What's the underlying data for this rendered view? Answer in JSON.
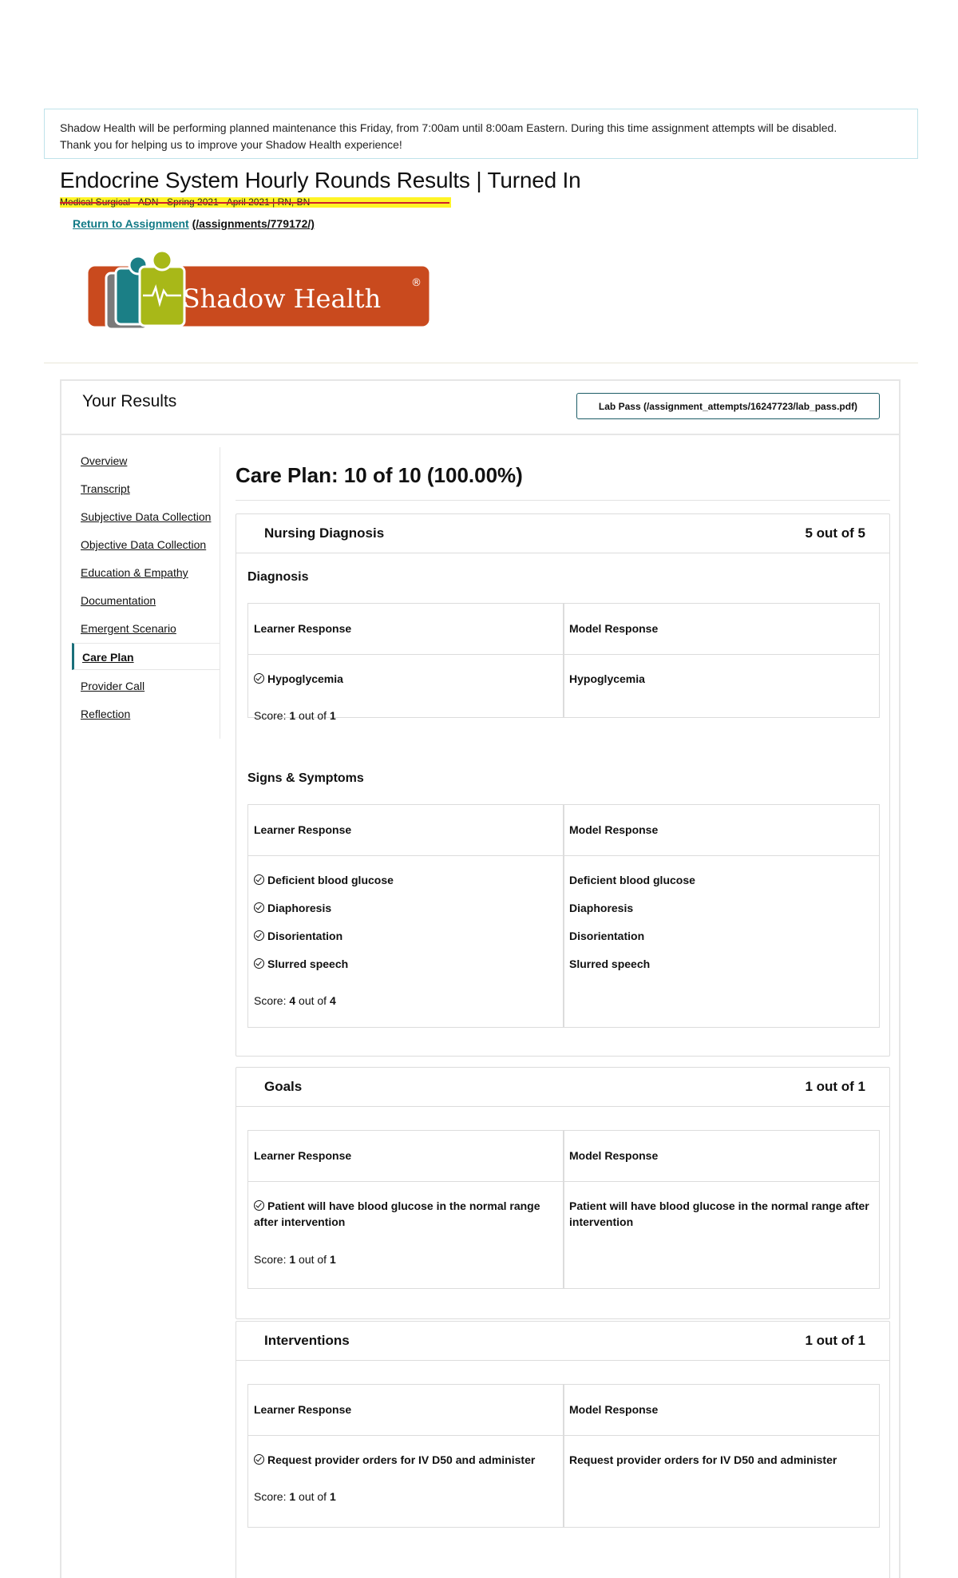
{
  "notice": {
    "line1": "Shadow Health will be performing planned maintenance this Friday, from 7:00am until 8:00am Eastern. During this time assignment attempts will be disabled.",
    "line2": "Thank you for helping us to improve your Shadow Health experience!"
  },
  "header": {
    "title": "Endocrine System Hourly Rounds Results | Turned In",
    "course": "Medical Surgical - ADN - Spring 2021 - April 2021 | RN, BN",
    "return_link": "Return to Assignment",
    "return_path": "(/assignments/779172/)"
  },
  "logo": {
    "text": "Shadow Health",
    "registered": "®",
    "icon": "shadow-health-logo-icon",
    "colors": {
      "bg": "#c94a1e",
      "green": "#a8b818",
      "teal": "#1b7f86",
      "gray": "#7a7a7a"
    }
  },
  "results": {
    "title": "Your Results",
    "lab_pass": "Lab Pass (/assignment_attempts/16247723/lab_pass.pdf)"
  },
  "sidebar": {
    "items": [
      {
        "label": "Overview"
      },
      {
        "label": "Transcript"
      },
      {
        "label": "Subjective Data Collection"
      },
      {
        "label": "Objective Data Collection"
      },
      {
        "label": "Education & Empathy"
      },
      {
        "label": "Documentation"
      },
      {
        "label": "Emergent Scenario"
      },
      {
        "label": "Care Plan",
        "active": true
      },
      {
        "label": "Provider Call"
      },
      {
        "label": "Reflection"
      }
    ]
  },
  "care_plan": {
    "title": "Care Plan: 10 of 10 (100.00%)",
    "learner_header": "Learner Response",
    "model_header": "Model Response",
    "score_label": "Score:",
    "out_of": "out of",
    "nursing_diagnosis": {
      "name": "Nursing Diagnosis",
      "score": "5 out of 5",
      "diagnosis": {
        "title": "Diagnosis",
        "learner": [
          "Hypoglycemia"
        ],
        "model": [
          "Hypoglycemia"
        ],
        "score": "1",
        "total": "1"
      },
      "signs": {
        "title": "Signs & Symptoms",
        "learner": [
          "Deficient blood glucose",
          "Diaphoresis",
          "Disorientation",
          "Slurred speech"
        ],
        "model": [
          "Deficient blood glucose",
          "Diaphoresis",
          "Disorientation",
          "Slurred speech"
        ],
        "score": "4",
        "total": "4"
      }
    },
    "goals": {
      "name": "Goals",
      "score": "1 out of 1",
      "learner": [
        "Patient will have blood glucose in the normal range after intervention"
      ],
      "model": [
        "Patient will have blood glucose in the normal range after intervention"
      ],
      "item_score": "1",
      "item_total": "1"
    },
    "interventions": {
      "name": "Interventions",
      "score": "1 out of 1",
      "learner": [
        "Request provider orders for IV D50 and administer"
      ],
      "model": [
        "Request provider orders for IV D50 and administer"
      ],
      "item_score": "1",
      "item_total": "1"
    }
  }
}
